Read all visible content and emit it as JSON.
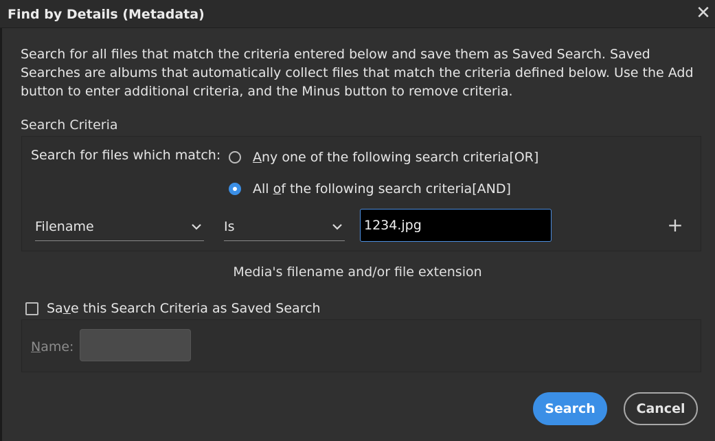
{
  "window": {
    "title": "Find by Details (Metadata)",
    "close_glyph": "✕"
  },
  "description": "Search for all files that match the criteria entered below and save them as Saved Search. Saved Searches are albums that automatically collect files that match the criteria defined below. Use the Add button to enter additional criteria, and the Minus button to remove criteria.",
  "criteria": {
    "section_label": "Search Criteria",
    "match_label": "Search for files which match:",
    "options": [
      {
        "label_pre": "",
        "label_ul": "A",
        "label_post": "ny one of the following search criteria[OR]",
        "selected": false
      },
      {
        "label_pre": "All ",
        "label_ul": "o",
        "label_post": "f the following search criteria[AND]",
        "selected": true
      }
    ],
    "row": {
      "field": "Filename",
      "operator": "Is",
      "value": "1234.jpg",
      "add_glyph": "+"
    },
    "hint": "Media's filename and/or file extension"
  },
  "saved_search": {
    "checkbox_label_pre": "Sa",
    "checkbox_label_ul": "v",
    "checkbox_label_post": "e this Search Criteria as Saved Search",
    "checked": false,
    "name_label_ul": "N",
    "name_label_post": "ame:",
    "name_value": ""
  },
  "buttons": {
    "search": "Search",
    "cancel": "Cancel"
  },
  "colors": {
    "background": "#303030",
    "accent": "#3b8fe6",
    "input_bg": "#000000"
  }
}
